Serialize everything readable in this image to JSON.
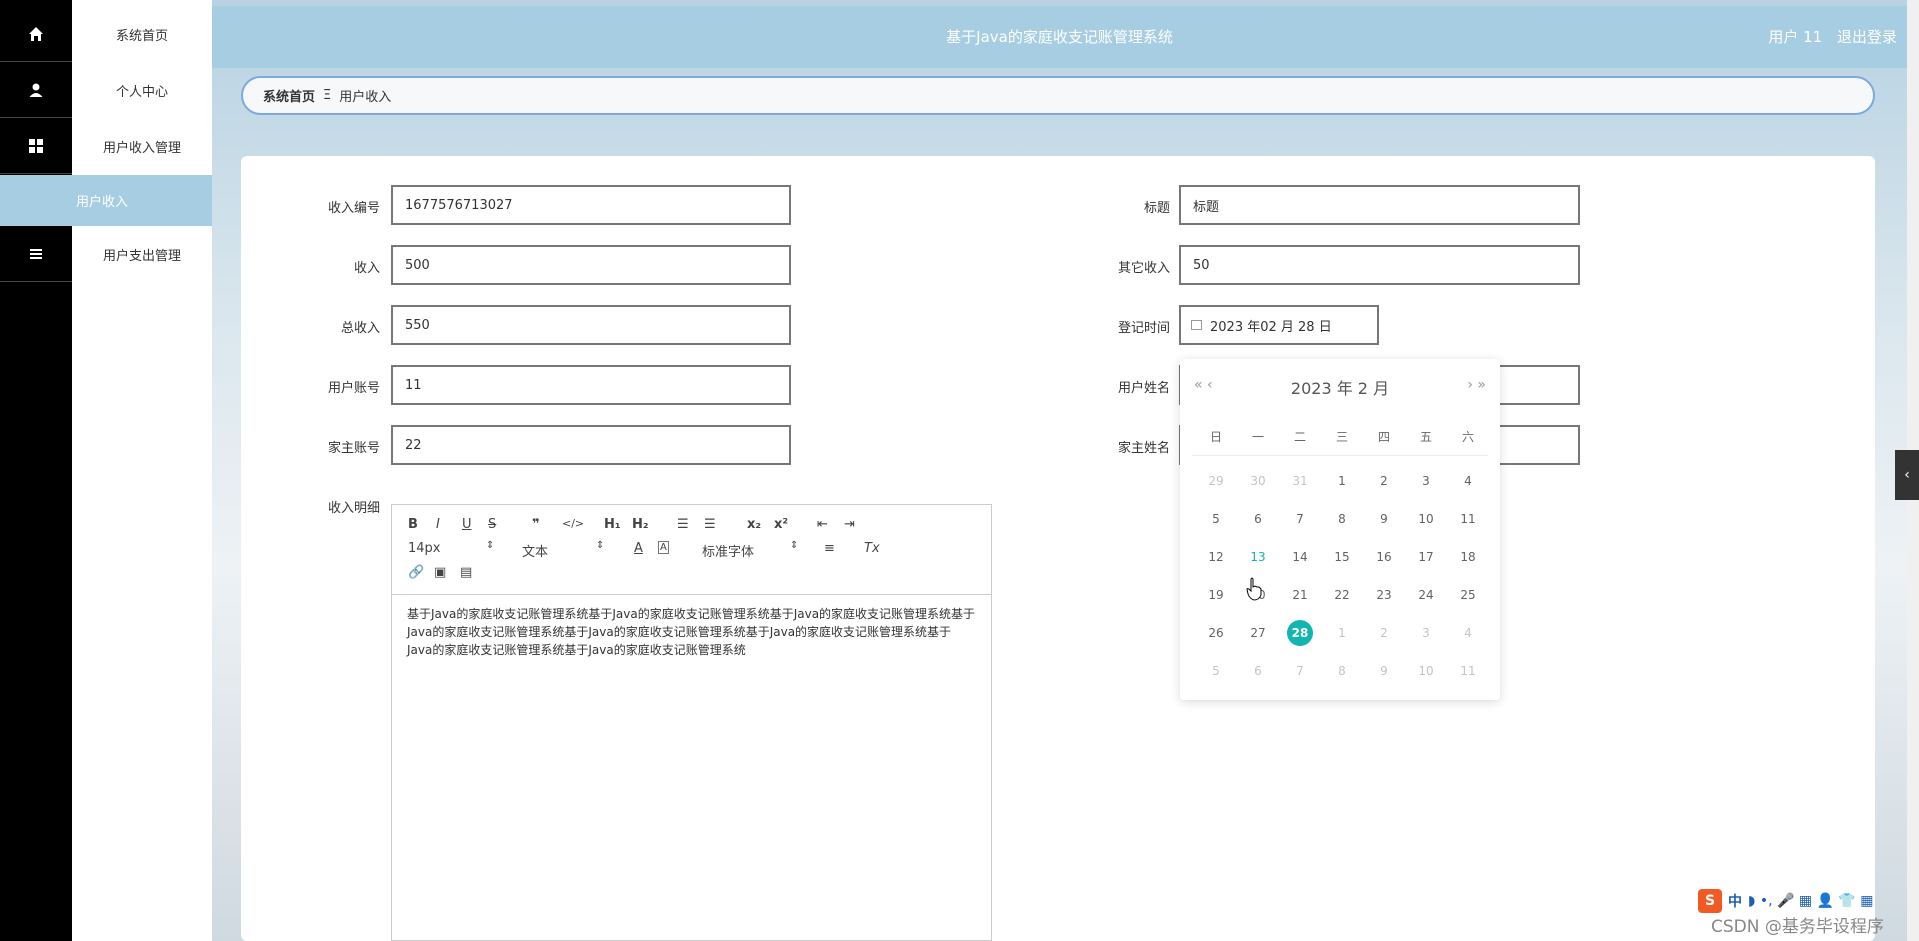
{
  "sidebar": {
    "items": [
      {
        "label": "系统首页",
        "icon": "home-icon"
      },
      {
        "label": "个人中心",
        "icon": "user-icon"
      },
      {
        "label": "用户收入管理",
        "icon": "grid-icon"
      },
      {
        "label": "用户支出管理",
        "icon": "list-icon"
      }
    ],
    "active_sub": "用户收入"
  },
  "header": {
    "title": "基于Java的家庭收支记账管理系统",
    "user": "用户 11",
    "logout": "退出登录"
  },
  "breadcrumb": {
    "home": "系统首页",
    "separator": "Ξ",
    "current": "用户收入"
  },
  "form": {
    "income_no": {
      "label": "收入编号",
      "value": "1677576713027"
    },
    "title": {
      "label": "标题",
      "value": "标题"
    },
    "income": {
      "label": "收入",
      "value": "500"
    },
    "other_income": {
      "label": "其它收入",
      "value": "50"
    },
    "total_income": {
      "label": "总收入",
      "value": "550"
    },
    "register_time": {
      "label": "登记时间",
      "value": "2023 年02 月 28 日"
    },
    "user_account": {
      "label": "用户账号",
      "value": "11"
    },
    "user_name": {
      "label": "用户姓名",
      "value": ""
    },
    "owner_account": {
      "label": "家主账号",
      "value": "22"
    },
    "owner_name": {
      "label": "家主姓名",
      "value": ""
    },
    "detail": {
      "label": "收入明细"
    }
  },
  "editor": {
    "font_size": "14px",
    "text_type": "文本",
    "font_family": "标准字体",
    "content": "基于Java的家庭收支记账管理系统基于Java的家庭收支记账管理系统基于Java的家庭收支记账管理系统基于Java的家庭收支记账管理系统基于Java的家庭收支记账管理系统基于Java的家庭收支记账管理系统基于Java的家庭收支记账管理系统基于Java的家庭收支记账管理系统"
  },
  "datepicker": {
    "year_month": "2023 年  2 月",
    "prev": "« ‹",
    "next": "› »",
    "weekdays": [
      "日",
      "一",
      "二",
      "三",
      "四",
      "五",
      "六"
    ],
    "weeks": [
      [
        "29",
        "30",
        "31",
        "1",
        "2",
        "3",
        "4"
      ],
      [
        "5",
        "6",
        "7",
        "8",
        "9",
        "10",
        "11"
      ],
      [
        "12",
        "13",
        "14",
        "15",
        "16",
        "17",
        "18"
      ],
      [
        "19",
        "20",
        "21",
        "22",
        "23",
        "24",
        "25"
      ],
      [
        "26",
        "27",
        "28",
        "1",
        "2",
        "3",
        "4"
      ],
      [
        "5",
        "6",
        "7",
        "8",
        "9",
        "10",
        "11"
      ]
    ],
    "today": "13",
    "selected": "28"
  },
  "ime": {
    "s": "S",
    "lang": "中",
    "extra": "◗ •, 🎤 ▦ 👤 👕 ▦"
  },
  "watermark": "CSDN @基务毕设程序",
  "colors": {
    "header": "#a7cde2",
    "accent": "#13b5b1",
    "sidebar": "#000000"
  }
}
